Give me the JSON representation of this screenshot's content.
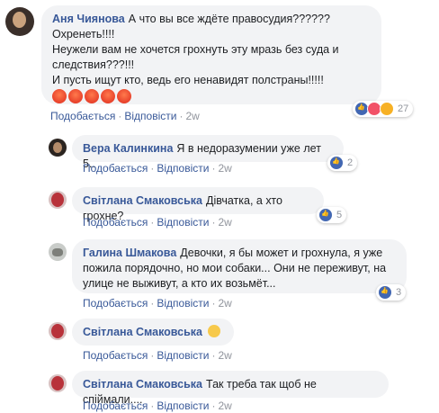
{
  "comments": [
    {
      "name": "Аня Чиянова",
      "text": "А что вы все ждёте правосудия??????\nОхренеть!!!!\nНеужели вам не хочется грохнуть эту мразь без суда и\nследствия???!!!\nИ пусть ищут кто, ведь его ненавидят полстраны!!!!!",
      "emoji": [
        "angry-emoji",
        "angry-emoji",
        "angry-emoji",
        "angry-emoji",
        "angry-emoji"
      ],
      "like": "Подобається",
      "reply": "Відповісти",
      "time": "2w",
      "reactions": [
        "like-icon",
        "love-icon",
        "haha-icon"
      ],
      "reaction_count": "27"
    },
    {
      "name": "Вера Калинкина",
      "text": "Я в недоразумении уже лет 5..",
      "like": "Подобається",
      "reply": "Відповісти",
      "time": "2w",
      "reactions": [
        "like-icon"
      ],
      "reaction_count": "2"
    },
    {
      "name": "Світлана Смаковська",
      "text": "Дівчатка, а хто грохне?",
      "like": "Подобається",
      "reply": "Відповісти",
      "time": "2w",
      "reactions": [
        "like-icon"
      ],
      "reaction_count": "5"
    },
    {
      "name": "Галина Шмакова",
      "text": "Девочки, я бы может и грохнула, я уже\nпожила порядочно, но мои собаки... Они не переживут, на\nулице не выживут, а кто их возьмёт...",
      "like": "Подобається",
      "reply": "Відповісти",
      "time": "2w",
      "reactions": [
        "like-icon"
      ],
      "reaction_count": "3"
    },
    {
      "name": "Світлана Смаковська",
      "text": "",
      "emoji": [
        "relieved-emoji"
      ],
      "like": "Подобається",
      "reply": "Відповісти",
      "time": "2w"
    },
    {
      "name": "Світлана Смаковська",
      "text": "Так треба так щоб не спіймали....",
      "like": "Подобається",
      "reply": "Відповісти",
      "time": "2w"
    }
  ],
  "colors": {
    "link": "#385898",
    "bubble": "#f2f3f5",
    "meta": "#90949c",
    "like": "#4267b2"
  }
}
